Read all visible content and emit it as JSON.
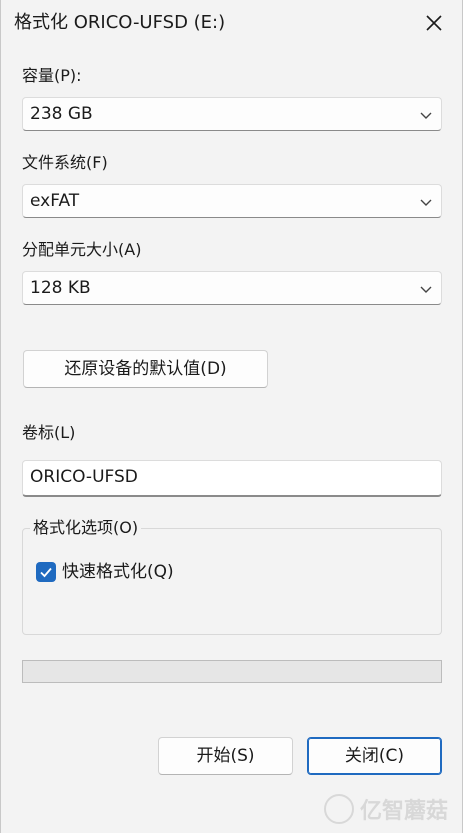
{
  "window": {
    "title": "格式化 ORICO-UFSD (E:)"
  },
  "capacity": {
    "label": "容量(P):",
    "value": "238 GB"
  },
  "file_system": {
    "label": "文件系统(F)",
    "value": "exFAT"
  },
  "allocation_unit": {
    "label": "分配单元大小(A)",
    "value": "128 KB"
  },
  "restore_defaults_button": "还原设备的默认值(D)",
  "volume_label": {
    "label": "卷标(L)",
    "value": "ORICO-UFSD"
  },
  "format_options": {
    "legend": "格式化选项(O)",
    "quick_format": {
      "label": "快速格式化(Q)",
      "checked": true
    }
  },
  "progress": {
    "value": 0
  },
  "footer": {
    "start_label": "开始(S)",
    "close_label": "关闭(C)"
  },
  "watermark": {
    "text": "亿智蘑菇"
  },
  "colors": {
    "accent": "#1f6ac0",
    "background": "#f3f3f3"
  }
}
